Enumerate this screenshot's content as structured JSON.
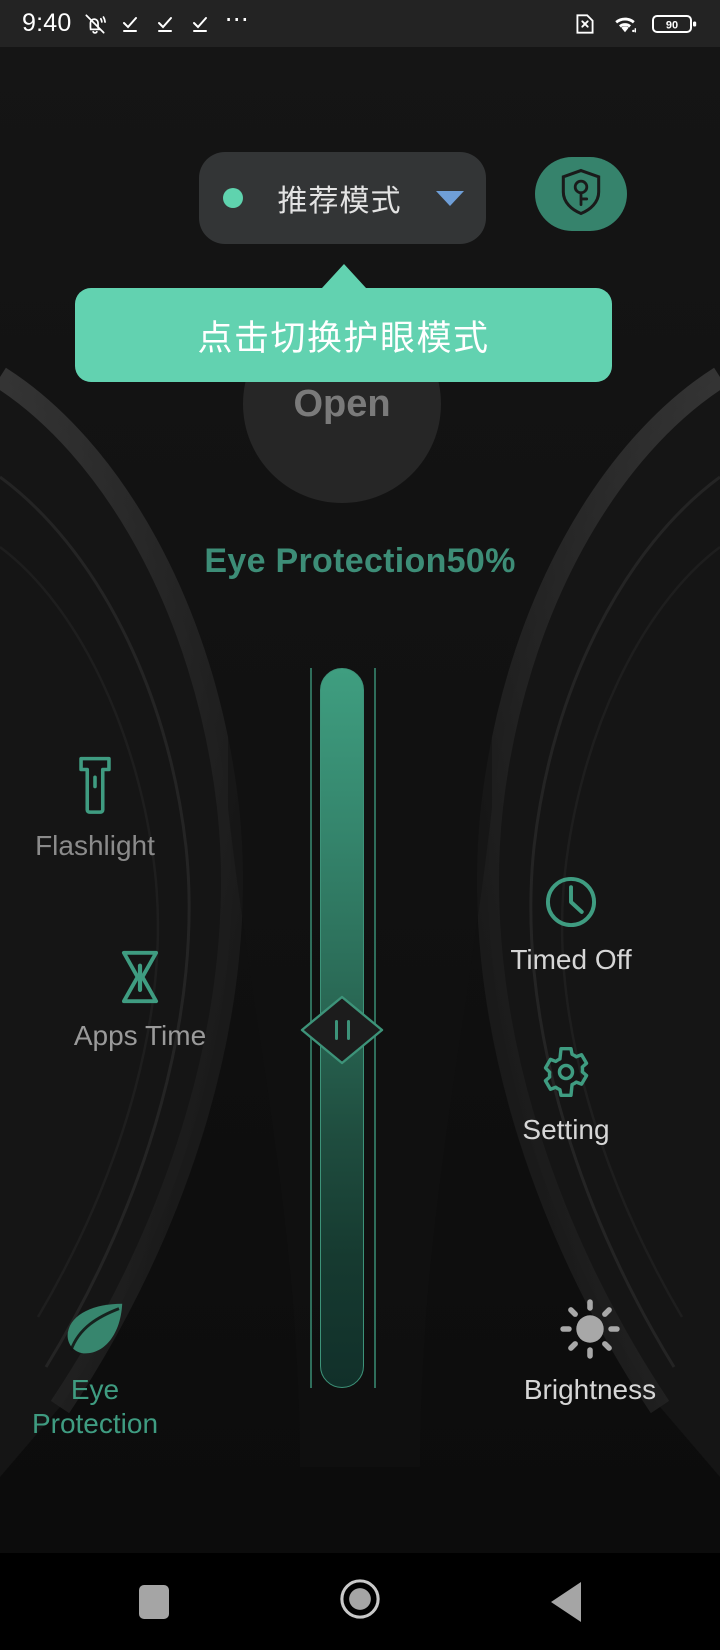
{
  "status_bar": {
    "time": "9:40",
    "icons_left": [
      "mute-icon",
      "check-icon",
      "check-icon",
      "check-icon",
      "more-dots-icon"
    ],
    "icons_right": [
      "sim-error-icon",
      "wifi-icon",
      "battery-icon"
    ],
    "battery_level": "90"
  },
  "mode_selector": {
    "label": "推荐模式",
    "dot_color": "#5fd3ae",
    "caret_color": "#6f9fd8",
    "icon": "chevron-down-icon"
  },
  "shield_button": {
    "icon": "shield-key-icon",
    "color": "#36836c"
  },
  "tooltip": {
    "text": "点击切换护眼模式",
    "background": "#62d2b0",
    "text_color": "#ffffff"
  },
  "power_button": {
    "label": "Open"
  },
  "title": {
    "text": "Eye Protection50%",
    "color": "#3d8d77"
  },
  "slider": {
    "value_percent": 50,
    "icon": "drag-handle-icon",
    "accent": "#3f9e80"
  },
  "quick_items": [
    {
      "id": "flashlight",
      "label": "Flashlight",
      "icon": "flashlight-icon",
      "color": "#8b8b8b"
    },
    {
      "id": "apps-time",
      "label": "Apps Time",
      "icon": "hourglass-icon",
      "color": "#9a9a9a"
    },
    {
      "id": "timed-off",
      "label": "Timed Off",
      "icon": "clock-icon",
      "color": "#d6d6d6"
    },
    {
      "id": "setting",
      "label": "Setting",
      "icon": "gear-icon",
      "color": "#d6d6d6"
    },
    {
      "id": "eye-protection",
      "label": "Eye Protection",
      "icon": "leaf-icon",
      "color": "#3f9c81"
    },
    {
      "id": "brightness",
      "label": "Brightness",
      "icon": "sun-icon",
      "color": "#d6d6d6"
    }
  ],
  "nav_bar": {
    "recents": "square-icon",
    "home": "circle-icon",
    "back": "triangle-back-icon"
  }
}
